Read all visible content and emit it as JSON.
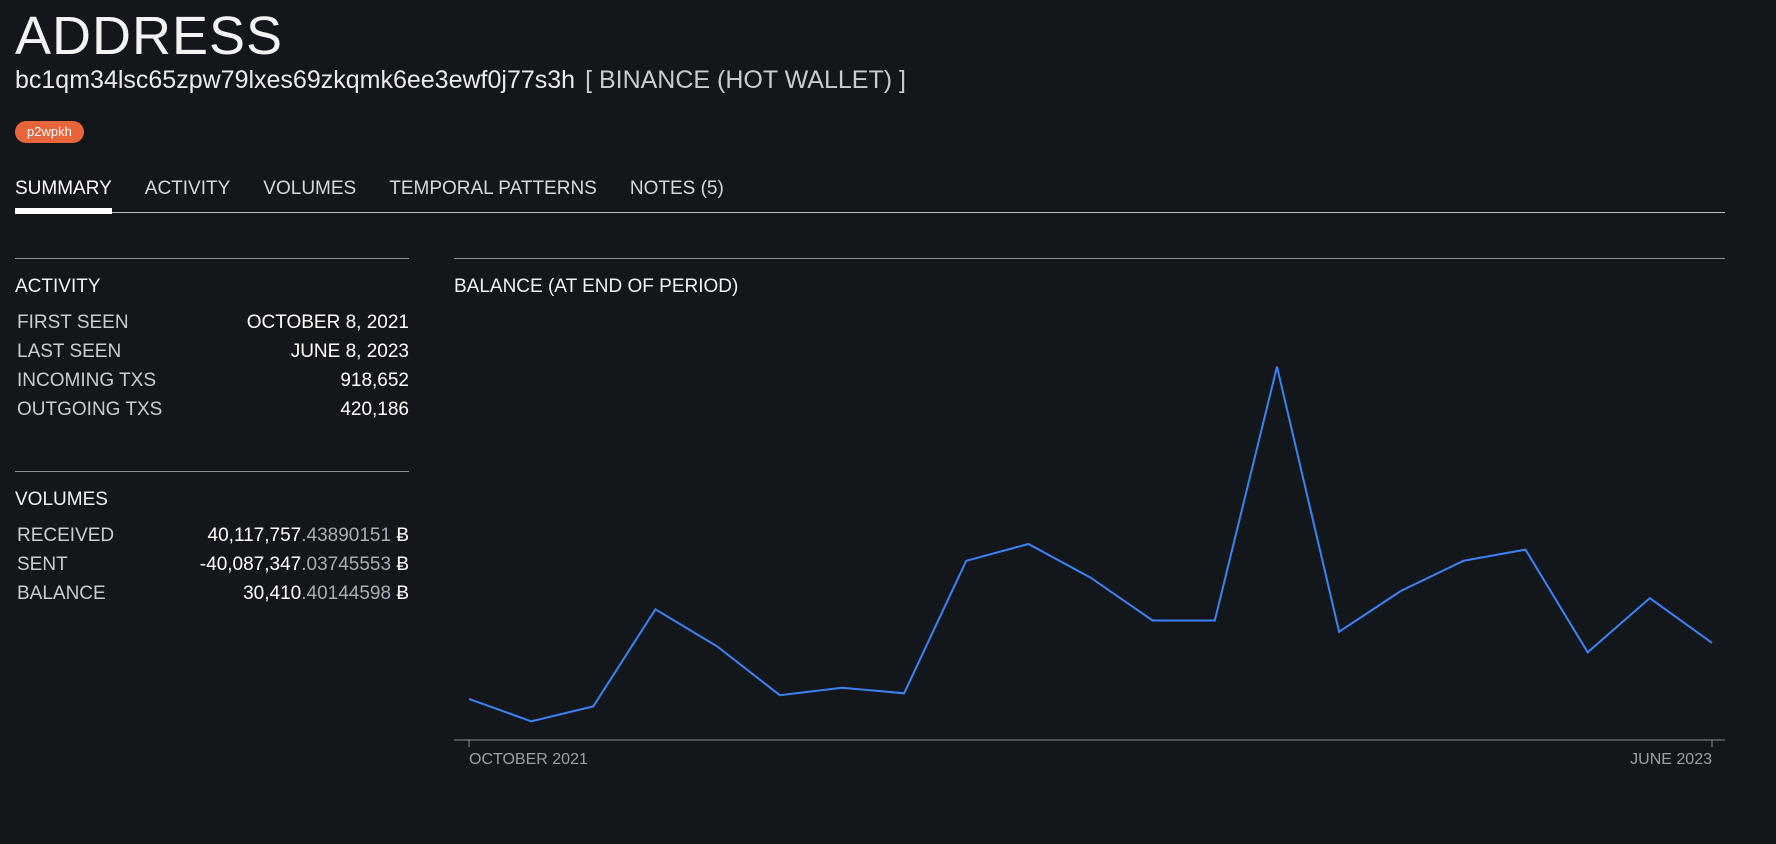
{
  "page": {
    "title": "ADDRESS",
    "address": "bc1qm34lsc65zpw79lxes69zkqmk6ee3ewf0j77s3h",
    "owner": "[ BINANCE (HOT WALLET) ]",
    "tag": "p2wpkh"
  },
  "tabs": [
    {
      "label": "SUMMARY",
      "active": true
    },
    {
      "label": "ACTIVITY",
      "active": false
    },
    {
      "label": "VOLUMES",
      "active": false
    },
    {
      "label": "TEMPORAL PATTERNS",
      "active": false
    },
    {
      "label": "NOTES (5)",
      "active": false
    }
  ],
  "activity": {
    "title": "ACTIVITY",
    "rows": [
      {
        "label": "FIRST SEEN",
        "value": "OCTOBER 8, 2021"
      },
      {
        "label": "LAST SEEN",
        "value": "JUNE 8, 2023"
      },
      {
        "label": "INCOMING TXS",
        "value": "918,652"
      },
      {
        "label": "OUTGOING TXS",
        "value": "420,186"
      }
    ]
  },
  "volumes": {
    "title": "VOLUMES",
    "rows": [
      {
        "label": "RECEIVED",
        "int": "40,117,757",
        "dec": ".43890151",
        "unit": " Ƀ"
      },
      {
        "label": "SENT",
        "int": "-40,087,347",
        "dec": ".03745553",
        "unit": " Ƀ"
      },
      {
        "label": "BALANCE",
        "int": "30,410",
        "dec": ".40144598",
        "unit": " Ƀ"
      }
    ]
  },
  "colors": {
    "background": "#13171c",
    "line": "#3b82f6",
    "tag": "#e8643b"
  },
  "chart_data": {
    "type": "line",
    "title": "BALANCE (AT END OF PERIOD)",
    "x": [
      "2021-10",
      "2021-11",
      "2021-12",
      "2022-01",
      "2022-02",
      "2022-03",
      "2022-04",
      "2022-05",
      "2022-06",
      "2022-07",
      "2022-08",
      "2022-09",
      "2022-10",
      "2022-11",
      "2022-12",
      "2023-01",
      "2023-02",
      "2023-03",
      "2023-04",
      "2023-05",
      "2023-06"
    ],
    "x_tick_labels": [
      "OCTOBER 2021",
      "JUNE 2023"
    ],
    "series": [
      {
        "values": [
          11,
          5,
          9,
          35,
          25,
          12,
          14,
          12.5,
          48,
          52.5,
          43.5,
          32,
          32,
          100,
          29,
          40,
          48,
          51,
          23.5,
          38,
          26
        ]
      }
    ],
    "ylim": [
      0,
      105
    ],
    "y_axis_labels": false,
    "grid": false
  }
}
